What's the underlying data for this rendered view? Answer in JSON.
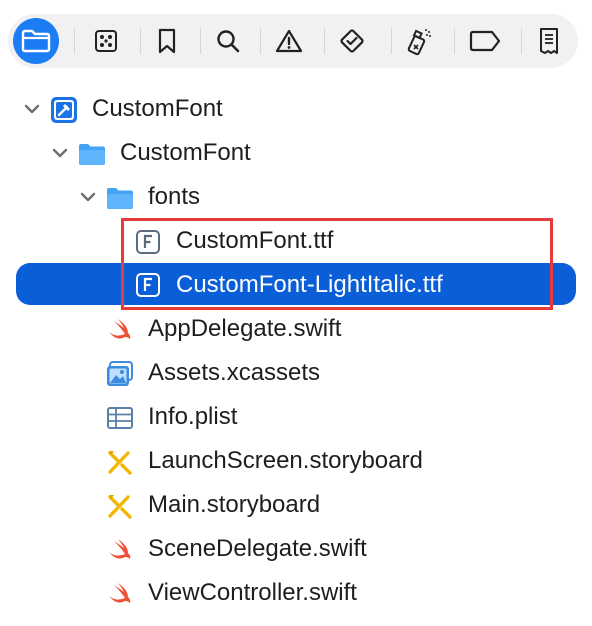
{
  "toolbar": {
    "active_tab": 0,
    "tabs": [
      {
        "icon": "folder-icon",
        "name": "project-navigator"
      },
      {
        "icon": "source-control-icon",
        "name": "source-control-navigator"
      },
      {
        "icon": "bookmark-icon",
        "name": "bookmark-navigator"
      },
      {
        "icon": "search-icon",
        "name": "find-navigator"
      },
      {
        "icon": "warning-icon",
        "name": "issue-navigator"
      },
      {
        "icon": "test-diamond-icon",
        "name": "test-navigator"
      },
      {
        "icon": "debug-spray-icon",
        "name": "debug-navigator"
      },
      {
        "icon": "breakpoint-tag-icon",
        "name": "breakpoint-navigator"
      },
      {
        "icon": "report-icon",
        "name": "report-navigator"
      }
    ]
  },
  "tree": {
    "items": [
      {
        "label": "CustomFont",
        "icon": "xcode-project-icon",
        "depth": 0,
        "expanded": true
      },
      {
        "label": "CustomFont",
        "icon": "folder-icon",
        "depth": 1,
        "expanded": true
      },
      {
        "label": "fonts",
        "icon": "folder-icon",
        "depth": 2,
        "expanded": true
      },
      {
        "label": "CustomFont.ttf",
        "icon": "font-file-icon",
        "depth": 3
      },
      {
        "label": "CustomFont-LightItalic.ttf",
        "icon": "font-file-icon",
        "depth": 3,
        "selected": true
      },
      {
        "label": "AppDelegate.swift",
        "icon": "swift-file-icon",
        "depth": 2
      },
      {
        "label": "Assets.xcassets",
        "icon": "asset-catalog-icon",
        "depth": 2
      },
      {
        "label": "Info.plist",
        "icon": "plist-table-icon",
        "depth": 2
      },
      {
        "label": "LaunchScreen.storyboard",
        "icon": "storyboard-icon",
        "depth": 2
      },
      {
        "label": "Main.storyboard",
        "icon": "storyboard-icon",
        "depth": 2
      },
      {
        "label": "SceneDelegate.swift",
        "icon": "swift-file-icon",
        "depth": 2
      },
      {
        "label": "ViewController.swift",
        "icon": "swift-file-icon",
        "depth": 2
      }
    ]
  },
  "colors": {
    "accent": "#1c7cf4",
    "selection": "#0a5ed7",
    "highlight_box": "#e63b3b",
    "folder": "#45a3f5",
    "swift": "#f05138"
  }
}
